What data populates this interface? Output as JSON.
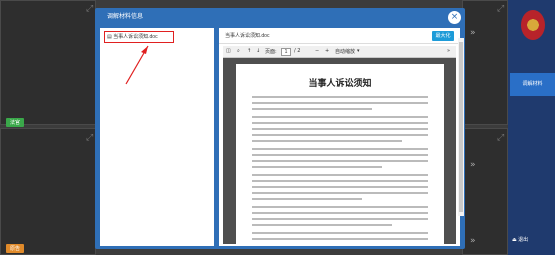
{
  "dialog": {
    "title": "调解材料信息",
    "close_glyph": "×"
  },
  "file_list": {
    "items": [
      {
        "label": "当事人诉讼须知.doc"
      }
    ]
  },
  "preview": {
    "title": "当事人诉讼须知.doc",
    "maximize_label": "最大化",
    "toolbar": {
      "page_label": "页面:",
      "page_current": "1",
      "page_total": "/ 2",
      "zoom_label": "自动缩放",
      "more_glyph": "»"
    },
    "document": {
      "heading": "当事人诉讼须知"
    }
  },
  "video_tiles": {
    "tag_top": "法官",
    "tag_bottom": "原告"
  },
  "sidebar": {
    "active_tab": "调解材料",
    "exit_label": "退出"
  },
  "colors": {
    "modal_header": "#2f6fb7",
    "accent_button": "#1d9bd8",
    "highlight_border": "#e02020",
    "sidebar_bg": "#1f3a6e"
  }
}
